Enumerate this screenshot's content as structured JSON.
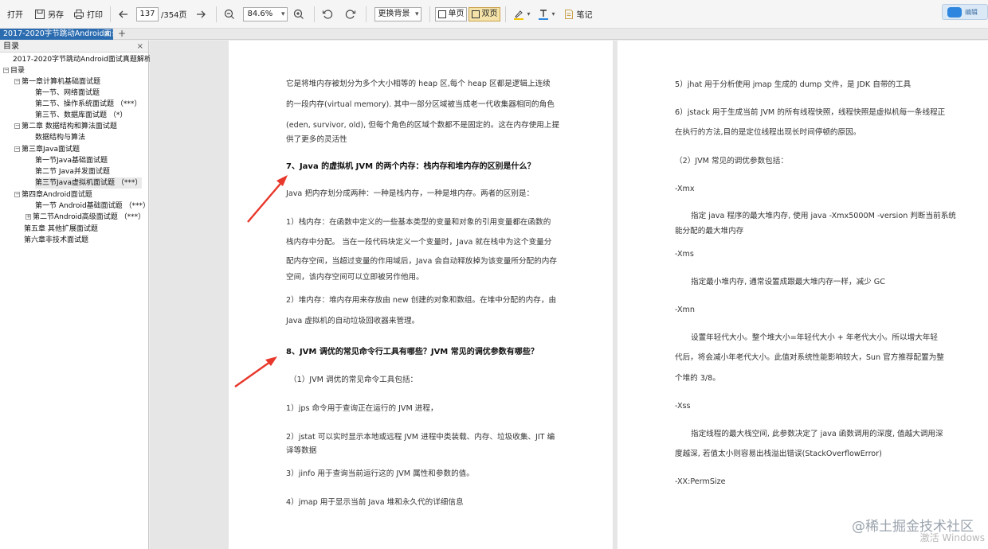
{
  "toolbar": {
    "open": "打开",
    "saveas": "另存",
    "print": "打印",
    "current_page": "137",
    "total_pages": "/354页",
    "zoom": "84.6%",
    "background": "更换背景",
    "single": "单页",
    "double": "双页",
    "notes": "笔记",
    "float_label": "编辑"
  },
  "tab": {
    "title": "2017-2020字节跳动Android面试",
    "close": "×",
    "add": "+"
  },
  "sidebar": {
    "title": "目录",
    "close": "×",
    "items": [
      {
        "label": "2017-2020字节跳动Android面试真题解析"
      },
      {
        "label": "目录",
        "toggle": "−"
      },
      {
        "label": "第一章计算机基础面试题",
        "toggle": "−"
      },
      {
        "label": "第一节、网络面试题"
      },
      {
        "label": "第二节、操作系统面试题 （***）"
      },
      {
        "label": "第三节、数据库面试题 （*）"
      },
      {
        "label": "第二章 数据结构和算法面试题",
        "toggle": "−"
      },
      {
        "label": "数据结构与算法"
      },
      {
        "label": "第三章Java面试题",
        "toggle": "−"
      },
      {
        "label": "第一节Java基础面试题"
      },
      {
        "label": "第二节 Java并发面试题"
      },
      {
        "label": "第三节Java虚拟机面试题 （***）"
      },
      {
        "label": "第四章Android面试题",
        "toggle": "−"
      },
      {
        "label": "第一节 Android基础面试题 （***）"
      },
      {
        "label": "第二节Android高级面试题 （***）",
        "toggle": "+"
      },
      {
        "label": "第五章 其他扩展面试题"
      },
      {
        "label": "第六章非技术面试题"
      }
    ]
  },
  "page_left": {
    "lines": [
      "它是将堆内存被划分为多个大小相等的  heap 区,每个 heap 区都是逻辑上连续",
      "的一段内存(virtual memory). 其中一部分区域被当成老一代收集器相同的角色",
      "(eden, survivor, old), 但每个角色的区域个数都不是固定的。这在内存使用上提",
      "供了更多的灵活性",
      "7、Java 的虚拟机 JVM 的两个内存：栈内存和堆内存的区别是什么？",
      "Java 把内存划分成两种：一种是栈内存，一种是堆内存。两者的区别是：",
      "1）栈内存：在函数中定义的一些基本类型的变量和对象的引用变量都在函数的",
      "栈内存中分配。  当在一段代码块定义一个变量时，Java 就在栈中为这个变量分",
      "配内存空间，当超过变量的作用域后，Java 会自动释放掉为该变量所分配的内存",
      "空间，该内存空间可以立即被另作他用。",
      "2）堆内存：堆内存用来存放由 new 创建的对象和数组。在堆中分配的内存，由",
      "Java 虚拟机的自动垃圾回收器来管理。",
      "8、JVM 调优的常见命令行工具有哪些？JVM 常见的调优参数有哪些？",
      "（1）JVM 调优的常见命令工具包括：",
      "1）jps 命令用于查询正在运行的 JVM 进程，",
      "2）jstat 可以实时显示本地或远程 JVM 进程中类装载、内存、垃圾收集、JIT 编",
      "译等数据",
      "3）jinfo 用于查询当前运行这的 JVM 属性和参数的值。",
      "4）jmap 用于显示当前 Java 堆和永久代的详细信息"
    ]
  },
  "page_right": {
    "lines": [
      "5）jhat 用于分析使用 jmap 生成的 dump 文件，是 JDK 自带的工具",
      "6）jstack 用于生成当前 JVM 的所有线程快照，线程快照是虚拟机每一条线程正",
      "在执行的方法,目的是定位线程出现长时间停顿的原因。",
      "（2）JVM 常见的调优参数包括：",
      "-Xmx",
      "指定 java 程序的最大堆内存, 使用 java -Xmx5000M -version 判断当前系统",
      "能分配的最大堆内存",
      "-Xms",
      "指定最小堆内存, 通常设置成跟最大堆内存一样，减少 GC",
      "-Xmn",
      "设置年轻代大小。整个堆大小=年轻代大小  +  年老代大小。所以增大年轻",
      "代后，将会减小年老代大小。此值对系统性能影响较大，Sun 官方推荐配置为整",
      "个堆的 3/8。",
      "-Xss",
      "指定线程的最大栈空间, 此参数决定了 java 函数调用的深度, 值越大调用深",
      "度越深, 若值太小则容易出栈溢出错误(StackOverflowError)",
      "-XX:PermSize"
    ]
  },
  "watermark": "@稀土掘金技术社区",
  "windows_watermark": "激活 Windows",
  "colors": {
    "tab_active": "#2b6cb0",
    "arrow": "#e8372b",
    "mode_active": "#f4e2a8"
  }
}
